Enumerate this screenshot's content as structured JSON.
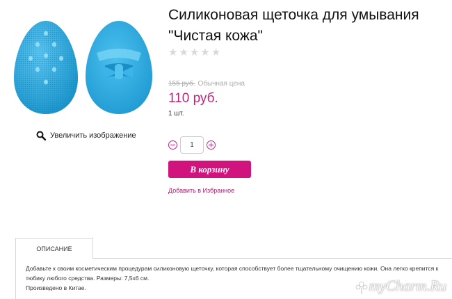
{
  "product": {
    "title": "Силиконовая щеточка для умывания \"Чистая кожа\"",
    "image_alt": "",
    "zoom_label": "Увеличить изображение",
    "rating": 0,
    "rating_max": 5,
    "old_price": "155 руб.",
    "old_price_label": "Обычная цена",
    "price": "110 руб.",
    "unit": "1 шт.",
    "quantity": "1",
    "cart_button": "В корзину",
    "favorites_link": "Добавить в Избранное"
  },
  "tabs": [
    {
      "label": "ОПИСАНИЕ"
    }
  ],
  "description": {
    "line1": "Добавьте к своим косметическим процедурам силиконовую щеточку, которая способствует более тщательному очищению кожи. Она легко крепится к",
    "line2": "тюбику любого средства. Размеры: 7,5х6 см.",
    "line3": "Произведено в Китае."
  },
  "watermark": "myCharm.Ru",
  "colors": {
    "accent": "#c1237e",
    "button": "#d1137e",
    "brush": "#29a8df"
  },
  "icons": {
    "zoom": "magnifier-icon",
    "minus": "minus-circle-icon",
    "plus": "plus-circle-icon",
    "star": "star-icon"
  }
}
